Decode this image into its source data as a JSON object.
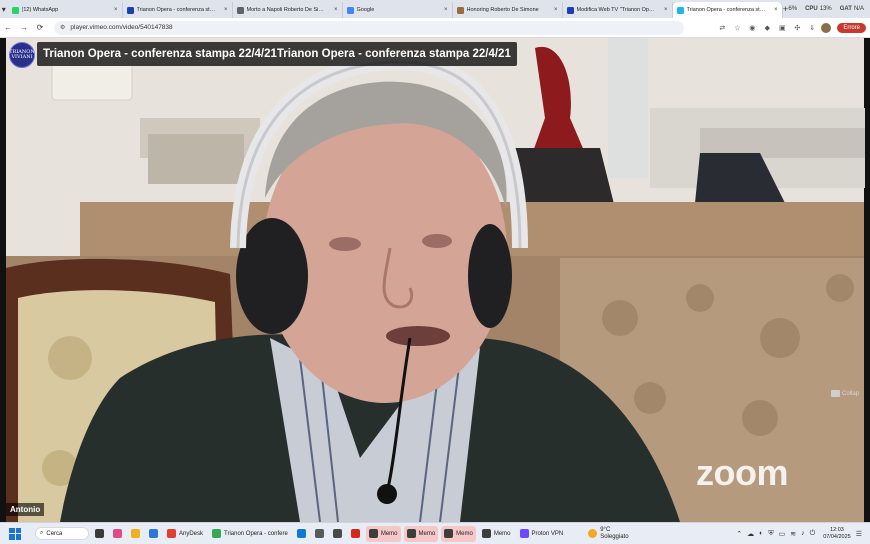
{
  "browser": {
    "tabs": [
      {
        "label": "(12) WhatsApp",
        "color": "#25d366",
        "active": false
      },
      {
        "label": "Trianon Opera - conferenza st…",
        "color": "#1a3fb5",
        "active": false
      },
      {
        "label": "Morto a Napoli Roberto De Si…",
        "color": "#5f6368",
        "active": false
      },
      {
        "label": "Google",
        "color": "#4285f4",
        "active": false
      },
      {
        "label": "Honoring Roberto De Simone",
        "color": "#9b6b3d",
        "active": false
      },
      {
        "label": "Modifica Web TV \"Trianon Op…",
        "color": "#1a3fb5",
        "active": false
      },
      {
        "label": "Trianon Opera - conferenza st…",
        "color": "#1ab7ea",
        "active": true
      }
    ],
    "stats": [
      {
        "label": "",
        "value": "6%"
      },
      {
        "label": "CPU",
        "value": "13%"
      },
      {
        "label": "GAT",
        "value": "N/A"
      }
    ],
    "url": "player.vimeo.com/video/540147838",
    "error_label": "Errore"
  },
  "video": {
    "channel_logo_text": "TRIANON VIVIANI",
    "title": "Trianon Opera - conferenza stampa 22/4/21Trianon Opera - conferenza stampa 22/4/21",
    "watermark": "zoom",
    "speaker_name": "Antonio",
    "side_label": "Collap"
  },
  "taskbar": {
    "search_label": "Cerca",
    "apps": [
      {
        "label": "",
        "color": "#3b3b3b",
        "active": false
      },
      {
        "label": "",
        "color": "#e04a8a",
        "active": false
      },
      {
        "label": "",
        "color": "#f2b01e",
        "active": false
      },
      {
        "label": "",
        "color": "#2b78d6",
        "active": false
      },
      {
        "label": "AnyDesk",
        "color": "#e0402f",
        "active": false
      },
      {
        "label": "Trianon Opera - confere",
        "color": "#34a853",
        "active": false
      },
      {
        "label": "",
        "color": "#0f7ad6",
        "active": false
      },
      {
        "label": "",
        "color": "#5a5a5a",
        "active": false
      },
      {
        "label": "",
        "color": "#4a4a4a",
        "active": false
      },
      {
        "label": "",
        "color": "#d4281f",
        "active": false
      },
      {
        "label": "Memo",
        "color": "#3d3d3d",
        "active": true
      },
      {
        "label": "Memo",
        "color": "#3d3d3d",
        "active": true
      },
      {
        "label": "Memo",
        "color": "#3d3d3d",
        "active": true
      },
      {
        "label": "Memo",
        "color": "#3d3d3d",
        "active": false
      },
      {
        "label": "Proton VPN",
        "color": "#6d4aff",
        "active": false
      }
    ],
    "weather": {
      "temp": "9°C",
      "desc": "Soleggiato"
    },
    "clock": {
      "time": "12:03",
      "date": "07/04/2025"
    }
  }
}
